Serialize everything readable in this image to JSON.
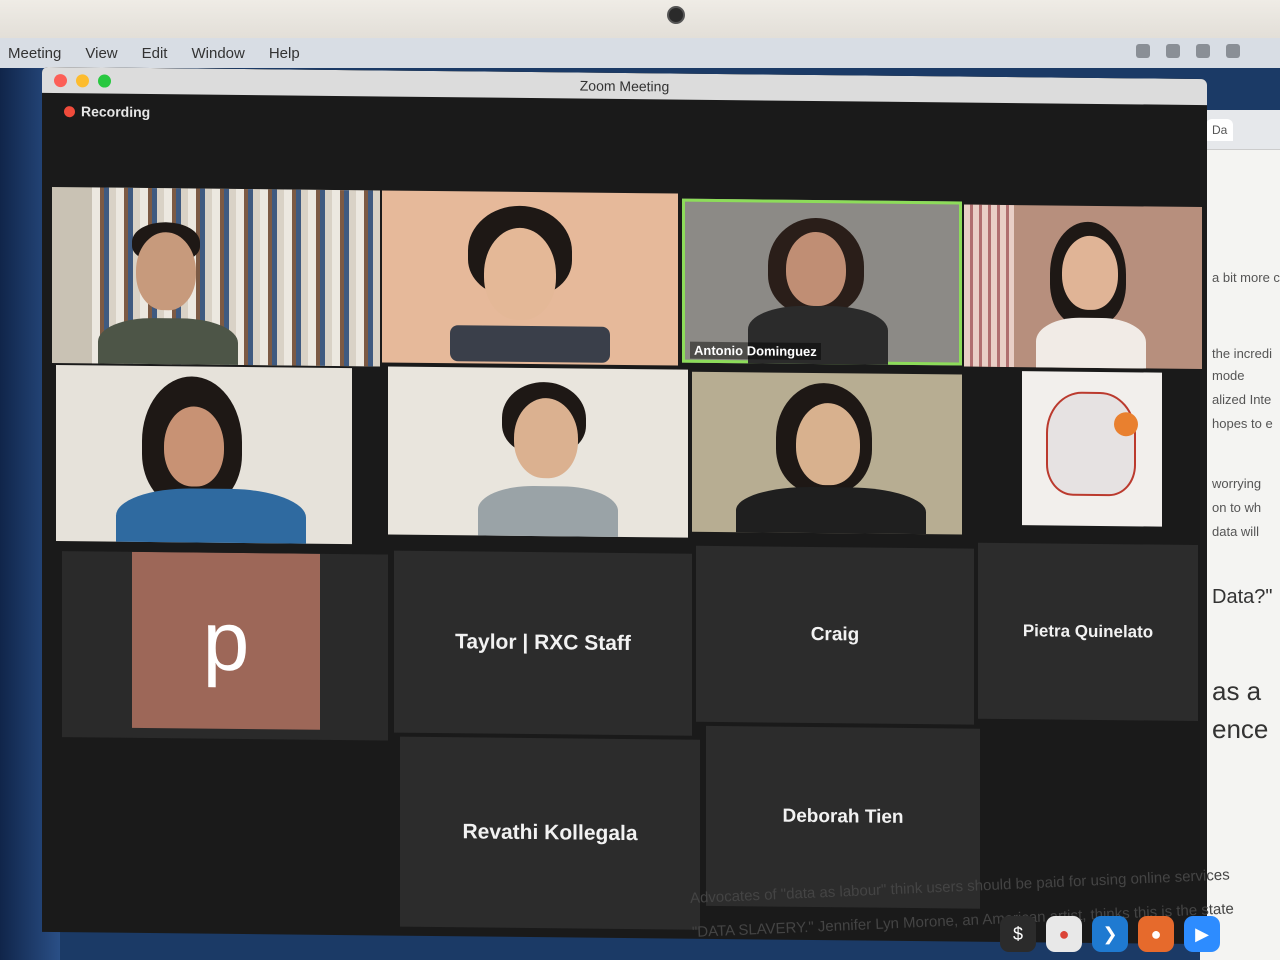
{
  "menubar": {
    "items": [
      "Meeting",
      "View",
      "Edit",
      "Window",
      "Help"
    ]
  },
  "window": {
    "title": "Zoom Meeting",
    "recording_label": "Recording"
  },
  "participants": {
    "active_speaker": "Antonio Dominguez",
    "avatar_initial": "p",
    "name_tiles": [
      "Taylor | RXC Staff",
      "Craig",
      "Pietra Quinelato",
      "Revathi Kollegala",
      "Deborah Tien"
    ]
  },
  "browser": {
    "tab_label": "Da",
    "snippets": [
      "a bit more c",
      "the incredi",
      "mode",
      "alized Inte",
      "hopes to e",
      "worrying",
      "on to wh",
      "data will",
      "Data?\"",
      "as a",
      "ence"
    ]
  },
  "page_text": {
    "line1": "Advocates of \"data as labour\" think users should be paid for using online services",
    "line2": "\"DATA SLAVERY.\" Jennifer Lyn Morone, an American artist, thinks this is the state"
  },
  "colors": {
    "active_border": "#8ddc5a",
    "recording_dot": "#f04b3b",
    "avatar_bg": "#9d6758"
  }
}
